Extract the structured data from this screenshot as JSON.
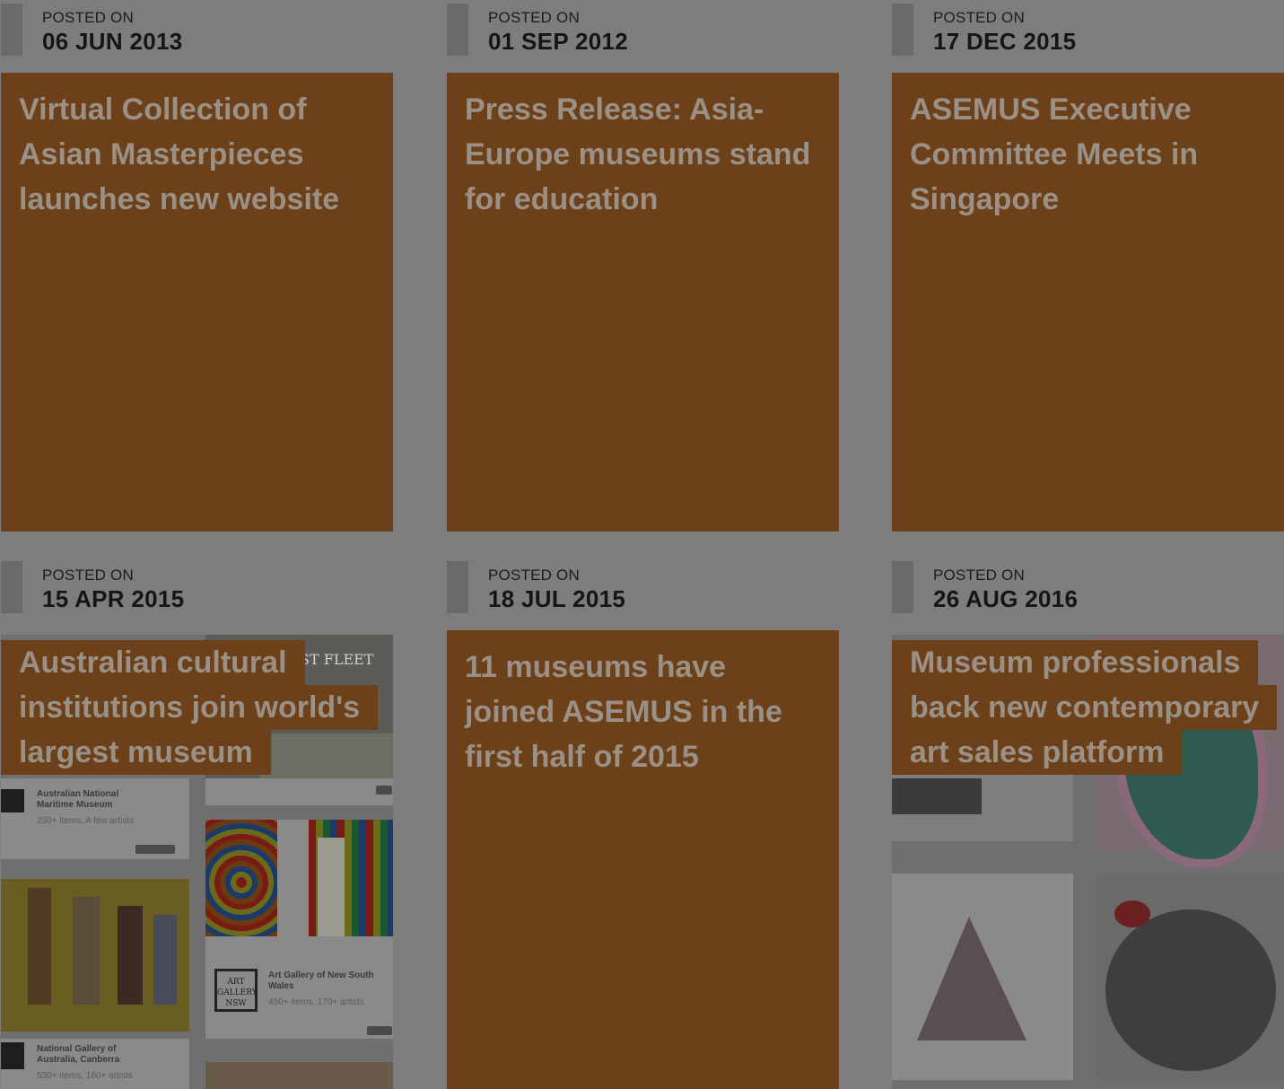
{
  "posts": [
    {
      "posted_label": "POSTED ON",
      "date": "06 JUN 2013",
      "title": "Virtual Collection of Asian Masterpieces launches new website"
    },
    {
      "posted_label": "POSTED ON",
      "date": "01 SEP 2012",
      "title": "Press Release: Asia-Europe museums stand for education"
    },
    {
      "posted_label": "POSTED ON",
      "date": "17 DEC 2015",
      "title": "ASEMUS Executive Committee Meets in Singapore"
    },
    {
      "posted_label": "POSTED ON",
      "date": "15 APR 2015",
      "title": "Australian cultural institutions join world's largest museum"
    },
    {
      "posted_label": "POSTED ON",
      "date": "18 JUL 2015",
      "title": "11 museums have joined ASEMUS in the first half of 2015"
    },
    {
      "posted_label": "POSTED ON",
      "date": "26 AUG 2016",
      "title": "Museum professionals back new contemporary art sales platform"
    }
  ],
  "thumb_text": {
    "fleet": "ST FLEET",
    "inst1": "Australian National Maritime Museum",
    "inst1_meta": "230+ items, A few artists",
    "inst2": "Art Gallery of New South Wales",
    "inst2_meta": "450+ items, 170+ artists",
    "inst3": "National Gallery of Australia, Canberra",
    "inst3_meta": "530+ items, 160+ artists",
    "art_logo": "ART GALLERY NSW"
  },
  "colors": {
    "card": "#6c4119",
    "title": "#9b9086",
    "page": "#7d7d7d"
  }
}
